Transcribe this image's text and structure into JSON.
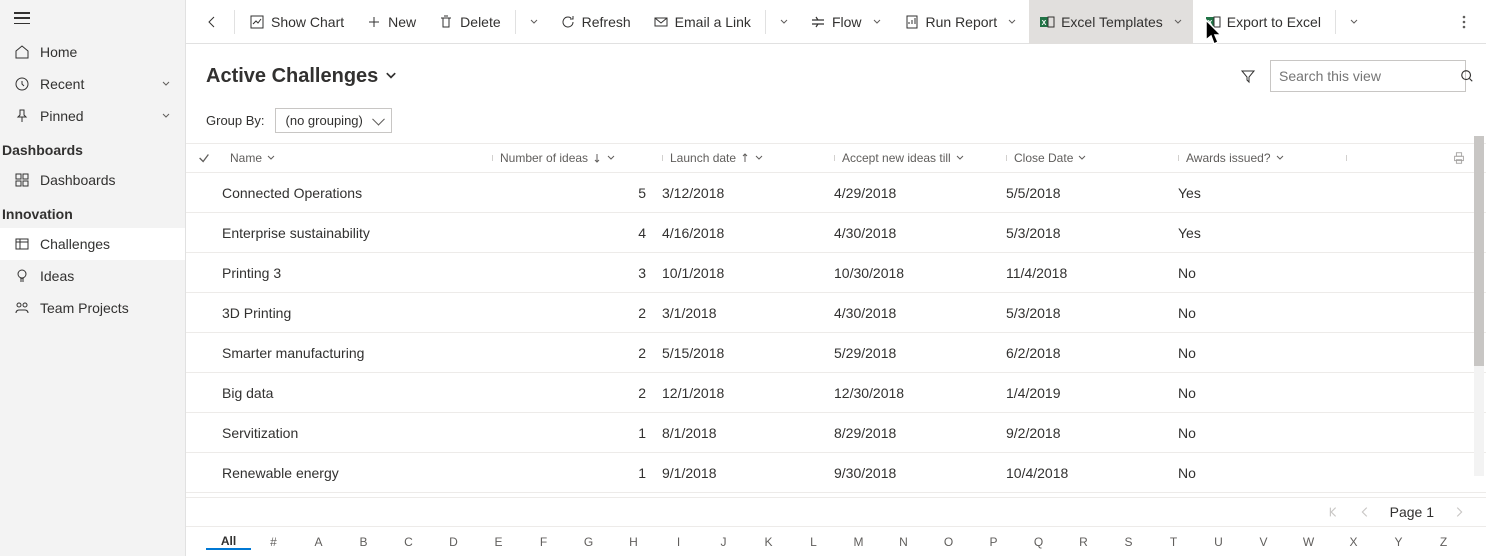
{
  "sidebar": {
    "home": "Home",
    "recent": "Recent",
    "pinned": "Pinned",
    "section_dashboards": "Dashboards",
    "dashboards": "Dashboards",
    "section_innovation": "Innovation",
    "challenges": "Challenges",
    "ideas": "Ideas",
    "team_projects": "Team Projects"
  },
  "toolbar": {
    "show_chart": "Show Chart",
    "new": "New",
    "delete": "Delete",
    "refresh": "Refresh",
    "email_link": "Email a Link",
    "flow": "Flow",
    "run_report": "Run Report",
    "excel_templates": "Excel Templates",
    "export_excel": "Export to Excel"
  },
  "view": {
    "title": "Active Challenges",
    "search_placeholder": "Search this view",
    "groupby_label": "Group By:",
    "groupby_value": "(no grouping)"
  },
  "columns": {
    "name": "Name",
    "ideas": "Number of ideas",
    "launch": "Launch date",
    "accept": "Accept new ideas till",
    "close": "Close Date",
    "awards": "Awards issued?"
  },
  "rows": [
    {
      "name": "Connected Operations",
      "ideas": "5",
      "launch": "3/12/2018",
      "accept": "4/29/2018",
      "close": "5/5/2018",
      "awards": "Yes"
    },
    {
      "name": "Enterprise sustainability",
      "ideas": "4",
      "launch": "4/16/2018",
      "accept": "4/30/2018",
      "close": "5/3/2018",
      "awards": "Yes"
    },
    {
      "name": "Printing 3",
      "ideas": "3",
      "launch": "10/1/2018",
      "accept": "10/30/2018",
      "close": "11/4/2018",
      "awards": "No"
    },
    {
      "name": "3D Printing",
      "ideas": "2",
      "launch": "3/1/2018",
      "accept": "4/30/2018",
      "close": "5/3/2018",
      "awards": "No"
    },
    {
      "name": "Smarter manufacturing",
      "ideas": "2",
      "launch": "5/15/2018",
      "accept": "5/29/2018",
      "close": "6/2/2018",
      "awards": "No"
    },
    {
      "name": "Big data",
      "ideas": "2",
      "launch": "12/1/2018",
      "accept": "12/30/2018",
      "close": "1/4/2019",
      "awards": "No"
    },
    {
      "name": "Servitization",
      "ideas": "1",
      "launch": "8/1/2018",
      "accept": "8/29/2018",
      "close": "9/2/2018",
      "awards": "No"
    },
    {
      "name": "Renewable energy",
      "ideas": "1",
      "launch": "9/1/2018",
      "accept": "9/30/2018",
      "close": "10/4/2018",
      "awards": "No"
    }
  ],
  "pager": {
    "page": "Page 1"
  },
  "alpha": [
    "All",
    "#",
    "A",
    "B",
    "C",
    "D",
    "E",
    "F",
    "G",
    "H",
    "I",
    "J",
    "K",
    "L",
    "M",
    "N",
    "O",
    "P",
    "Q",
    "R",
    "S",
    "T",
    "U",
    "V",
    "W",
    "X",
    "Y",
    "Z"
  ]
}
